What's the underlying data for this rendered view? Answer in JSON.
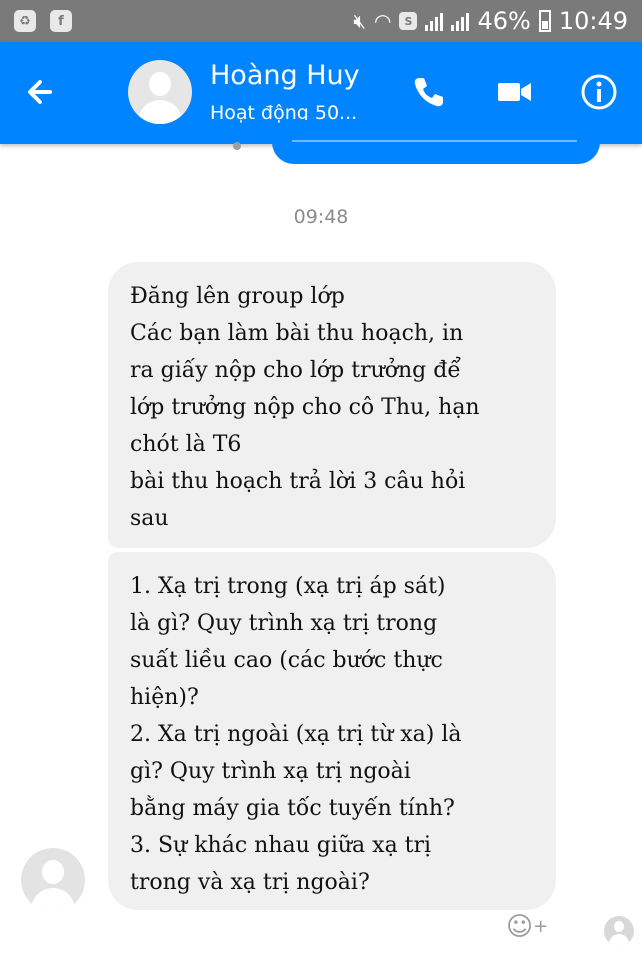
{
  "status_bar": {
    "battery": "46%",
    "time": "10:49",
    "icons": [
      "gallery-icon",
      "facebook-notification-icon",
      "mute-icon",
      "wifi-icon",
      "data-saver-icon",
      "signal-icon",
      "signal-icon",
      "battery-icon"
    ]
  },
  "header": {
    "name": "Hoàng Huy",
    "status": "Hoạt động 50...",
    "icons": [
      "back-arrow-icon",
      "phone-icon",
      "video-call-icon",
      "info-icon"
    ],
    "accent_color": "#0084ff"
  },
  "timestamp": "09:48",
  "messages": [
    {
      "lines": [
        "Đăng lên group lớp",
        "Các bạn làm bài thu hoạch, in",
        "ra giấy nộp cho lớp trưởng để",
        "lớp trưởng nộp cho cô Thu, hạn",
        "chót là T6",
        "bài thu hoạch trả lời 3 câu hỏi",
        "sau"
      ]
    },
    {
      "lines": [
        "1. Xạ trị trong (xạ trị áp sát)",
        "là gì? Quy trình xạ trị trong",
        "suất liều cao (các bước thực",
        "hiện)?",
        "2. Xa trị ngoài (xạ trị từ xa) là",
        "gì? Quy trình xạ trị ngoài",
        "bằng máy gia tốc tuyến tính?",
        "3. Sự khác nhau giữa xạ trị",
        "trong và xạ trị ngoài?"
      ]
    }
  ],
  "bubble_color": "#f0f0f0"
}
